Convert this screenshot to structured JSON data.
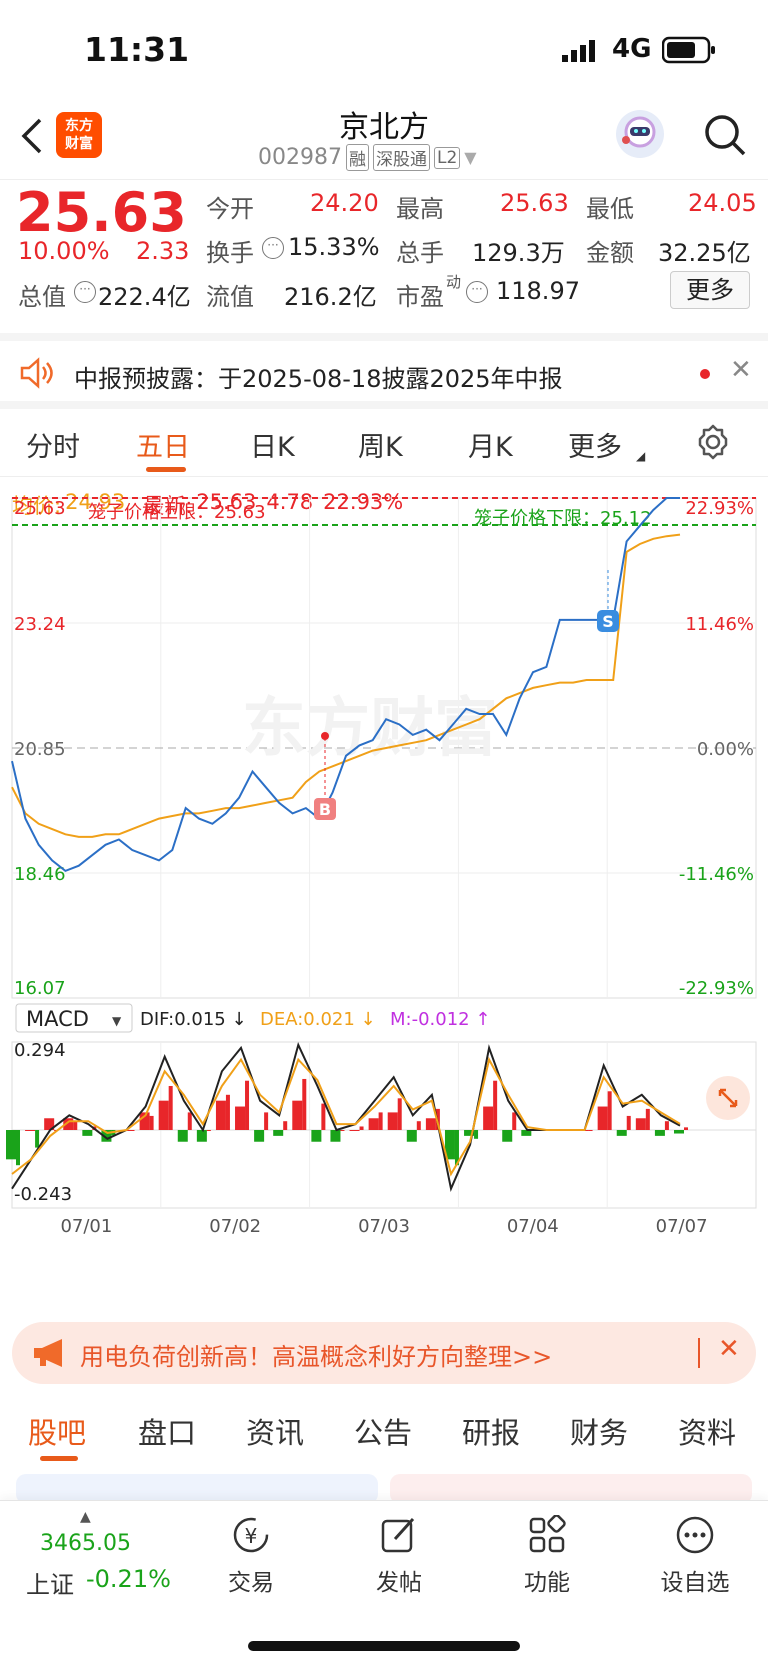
{
  "status_bar": {
    "time": "11:31",
    "network": "4G"
  },
  "header": {
    "app_logo": "东方\n财富",
    "stock_name": "京北方",
    "stock_code": "002987",
    "tags": [
      "融",
      "深股通",
      "L2"
    ]
  },
  "quote": {
    "price": "25.63",
    "change_pct": "10.00%",
    "change": "2.33",
    "fields": {
      "open_label": "今开",
      "open": "24.20",
      "high_label": "最高",
      "high": "25.63",
      "low_label": "最低",
      "low": "24.05",
      "turnover_label": "换手",
      "turnover": "15.33%",
      "volume_label": "总手",
      "volume": "129.3万",
      "amount_label": "金额",
      "amount": "32.25亿",
      "mktcap_label": "总值",
      "mktcap": "222.4亿",
      "float_label": "流值",
      "float": "216.2亿",
      "pe_label": "市盈",
      "pe_sup": "动",
      "pe": "118.97"
    },
    "more_button": "更多"
  },
  "notice": {
    "text": "中报预披露：于2025-08-18披露2025年中报"
  },
  "period_tabs": [
    "分时",
    "五日",
    "日K",
    "周K",
    "月K",
    "更多"
  ],
  "active_period": "五日",
  "chart_info": {
    "avg_label": "均价:",
    "avg": "24.93",
    "latest_label": "最新:",
    "latest": "25.63",
    "change": "4.78",
    "change_pct": "22.93%",
    "upper_cage": "笼子价格上限：25.63",
    "lower_cage": "笼子价格下限：25.12",
    "watermark": "东方财富",
    "marker_b": "B",
    "marker_s": "S"
  },
  "chart_data": {
    "type": "line",
    "ylim": [
      16.07,
      25.63
    ],
    "y_ticks_left": [
      "25.63",
      "23.24",
      "20.85",
      "18.46",
      "16.07"
    ],
    "y_ticks_right": [
      "22.93%",
      "11.46%",
      "0.00%",
      "-11.46%",
      "-22.93%"
    ],
    "x_ticks": [
      "07/01",
      "07/02",
      "07/03",
      "07/04",
      "07/07"
    ],
    "series": [
      {
        "name": "价格",
        "color": "#2b6fc6",
        "values": [
          20.6,
          19.5,
          19.0,
          18.7,
          18.5,
          18.6,
          18.8,
          19.0,
          19.1,
          18.9,
          18.8,
          18.7,
          18.9,
          19.7,
          19.5,
          19.4,
          19.6,
          19.9,
          20.4,
          20.1,
          19.8,
          19.6,
          19.7,
          19.5,
          20.0,
          20.7,
          20.9,
          21.0,
          21.4,
          21.3,
          21.1,
          21.2,
          21.0,
          21.3,
          21.6,
          21.5,
          21.5,
          21.1,
          21.8,
          22.3,
          22.4,
          23.3,
          23.3,
          23.3,
          23.3,
          23.3,
          24.8,
          25.1,
          25.4,
          25.63,
          25.63
        ]
      },
      {
        "name": "均价",
        "color": "#f0a018",
        "values": [
          20.1,
          19.6,
          19.4,
          19.3,
          19.2,
          19.15,
          19.15,
          19.2,
          19.2,
          19.3,
          19.4,
          19.5,
          19.55,
          19.6,
          19.6,
          19.65,
          19.7,
          19.7,
          19.75,
          19.8,
          19.85,
          19.9,
          20.2,
          20.4,
          20.5,
          20.6,
          20.7,
          20.8,
          20.85,
          20.9,
          20.95,
          21.0,
          21.1,
          21.2,
          21.3,
          21.4,
          21.6,
          21.8,
          21.9,
          22.0,
          22.05,
          22.1,
          22.1,
          22.15,
          22.15,
          22.15,
          24.6,
          24.75,
          24.85,
          24.9,
          24.93
        ]
      }
    ],
    "macd": {
      "selector": "MACD",
      "dif_label": "DIF:0.015 ↓",
      "dea_label": "DEA:0.021 ↓",
      "m_label": "M:-0.012 ↑",
      "ymax": "0.294",
      "ymin": "-0.243",
      "dif": [
        -0.2,
        -0.1,
        0.0,
        0.05,
        0.02,
        -0.03,
        0.0,
        0.08,
        0.25,
        0.1,
        0.0,
        0.2,
        0.28,
        0.1,
        0.05,
        0.29,
        0.15,
        0.0,
        0.02,
        0.1,
        0.18,
        0.05,
        0.12,
        -0.2,
        -0.05,
        0.28,
        0.1,
        0.0,
        0.0,
        0.0,
        0.0,
        0.22,
        0.08,
        0.12,
        0.05,
        0.015
      ],
      "dea": [
        -0.15,
        -0.1,
        -0.02,
        0.03,
        0.03,
        -0.01,
        0.0,
        0.05,
        0.2,
        0.12,
        0.02,
        0.15,
        0.24,
        0.12,
        0.06,
        0.24,
        0.17,
        0.02,
        0.02,
        0.08,
        0.15,
        0.07,
        0.1,
        -0.15,
        -0.04,
        0.24,
        0.12,
        0.01,
        0.0,
        0.0,
        0.0,
        0.18,
        0.09,
        0.1,
        0.06,
        0.021
      ]
    }
  },
  "promo": {
    "text": "用电负荷创新高！高温概念利好方向整理>>"
  },
  "bottom_tabs": [
    "股吧",
    "盘口",
    "资讯",
    "公告",
    "研报",
    "财务",
    "资料"
  ],
  "active_bottom_tab": "股吧",
  "dock": {
    "index_value": "3465.05",
    "index_name": "上证",
    "index_change": "-0.21%",
    "items": [
      "交易",
      "发帖",
      "功能",
      "设自选"
    ]
  }
}
